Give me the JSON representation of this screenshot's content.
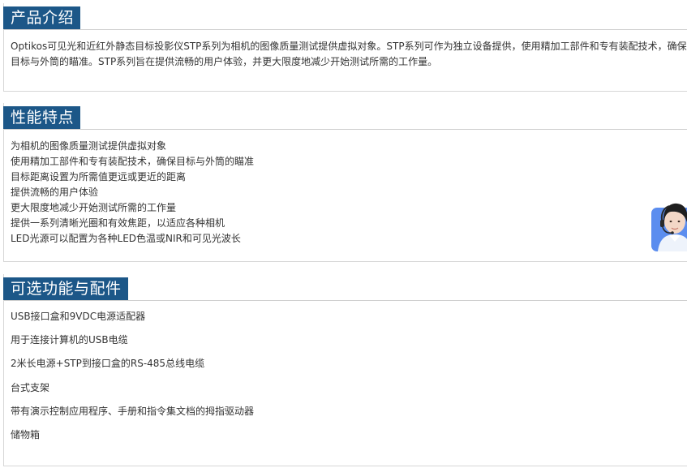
{
  "intro": {
    "title": "产品介绍",
    "body": "Optikos可见光和近红外静态目标投影仪STP系列为相机的图像质量测试提供虚拟对象。STP系列可作为独立设备提供，使用精加工部件和专有装配技术，确保目标与外筒的瞄准。STP系列旨在提供流畅的用户体验，并更大限度地减少开始测试所需的工作量。"
  },
  "features": {
    "title": "性能特点",
    "items": [
      "为相机的图像质量测试提供虚拟对象",
      "使用精加工部件和专有装配技术，确保目标与外筒的瞄准",
      "目标距离设置为所需值更远或更近的距离",
      "提供流畅的用户体验",
      "更大限度地减少开始测试所需的工作量",
      "提供一系列清晰光圈和有效焦距，以适应各种相机",
      "LED光源可以配置为各种LED色温或NIR和可见光波长"
    ]
  },
  "options": {
    "title": "可选功能与配件",
    "items": [
      "USB接口盒和9VDC电源适配器",
      "用于连接计算机的USB电缆",
      "2米长电源+STP到接口盒的RS-485总线电缆",
      "台式支架",
      "带有演示控制应用程序、手册和指令集文档的拇指驱动器",
      "储物箱"
    ]
  },
  "support_widget": {
    "icon": "customer-service-icon",
    "accent": "#5b8def"
  },
  "colors": {
    "tab_bg": "#1c5788",
    "tab_text": "#ffffff",
    "border": "#d6d6d6",
    "text": "#333333"
  }
}
